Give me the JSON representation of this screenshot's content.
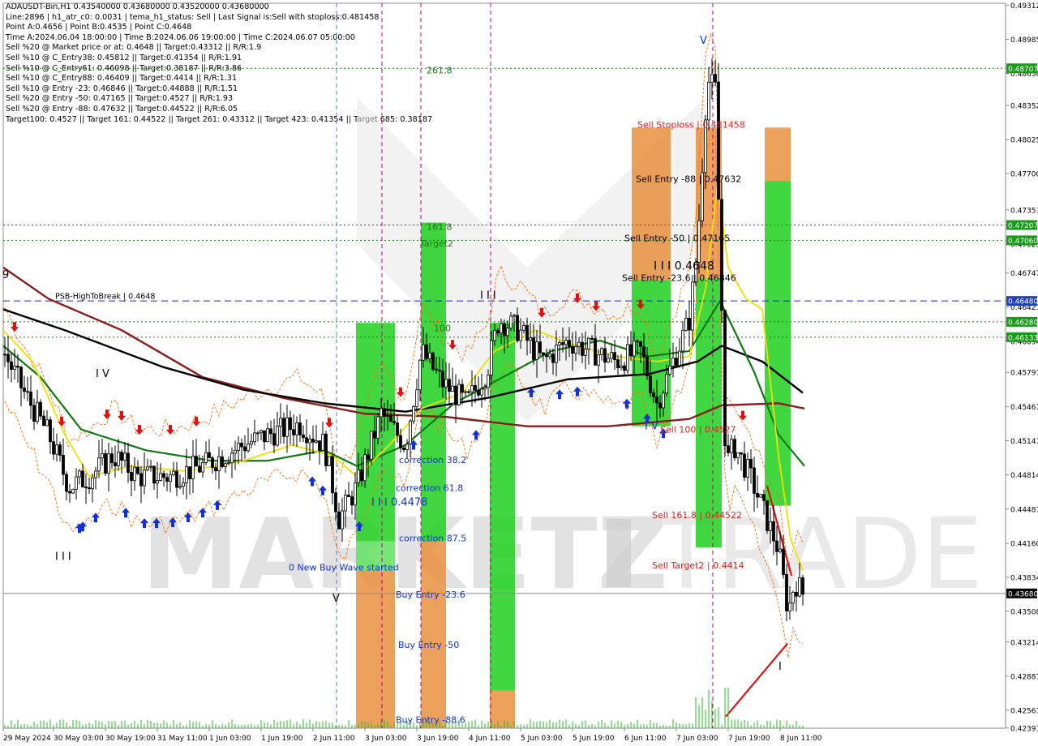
{
  "info_lines": [
    "ADAUSDT-Bin,H1  0.43540000 0.43680000 0.43520000 0.43680000",
    "Line:2896  |  h1_atr_c0: 0.0031  |  tema_h1_status: Sell  |  Last Signal is:Sell with stoploss:0.481458",
    "Point A:0.4656  |  Point B:0.4535  |  Point C:0.4648",
    "Time A:2024.06.04 18:00:00  |  Time B:2024.06.06 19:00:00  |  Time C:2024.06.07 05:00:00",
    "Sell %20 @ Market price or at: 0.4648  ||  Target:0.43312  ||  R/R:1.9",
    "Sell %10 @ C_Entry38: 0.45812  ||  Target:0.41354  ||  R/R:1.91",
    "Sell %10 @ C_Entry61: 0.46098  ||  Target:0.38187  ||  R/R:3.86",
    "Sell %10 @ C_Entry88: 0.46409  ||  Target:0.4414  ||  R/R:1.31",
    "Sell %10 @ Entry -23: 0.46846  ||  Target:0.44888  ||  R/R:1.51",
    "Sell %20 @ Entry -50: 0.47165  ||  Target:0.4527  ||  R/R:1.93",
    "Sell %20 @ Entry -88: 0.47632  ||  Target:0.44522  ||  R/R:6.05",
    "Target100: 0.4527  ||  Target 161: 0.44522  ||  Target 261: 0.43312  ||  Target 423: 0.41354  ||  Target 685: 0.38187"
  ],
  "colors": {
    "bg": "#ffffff",
    "grid": "#c8c8c8",
    "candle": "#000000",
    "ema_green": "#0f7a0f",
    "ema_black": "#000000",
    "ema_red": "#8b1c1c",
    "yellow": "#f0e000",
    "orange_band": "#ff6a00",
    "box_green": "#20d020",
    "box_orange": "#e89040",
    "magenta": "#c00080",
    "blue_dash": "#2020d0",
    "level_green": "#1a7a1a",
    "price_green_bg": "#1a9a1a",
    "buy_arrow": "#1030e0",
    "sell_arrow": "#e01010"
  },
  "chart_data": {
    "type": "candlestick",
    "symbol": "ADAUSDT-Bin,H1",
    "ylim": [
      0.4239,
      0.4933
    ],
    "y_ticks": [
      "0.49312",
      "0.48985",
      "0.48658",
      "0.48352",
      "0.48025",
      "0.47700",
      "0.47351",
      "0.47025",
      "0.46747",
      "0.46421",
      "0.46094",
      "0.45797",
      "0.45467",
      "0.45141",
      "0.44814",
      "0.44487",
      "0.44160",
      "0.43834",
      "0.43508",
      "0.43214",
      "0.42887",
      "0.42561",
      "0.42391"
    ],
    "y_tick_values": [
      0.49312,
      0.48985,
      0.48658,
      0.48352,
      0.48025,
      0.477,
      0.47351,
      0.47025,
      0.46747,
      0.46421,
      0.46094,
      0.45797,
      0.45467,
      0.45141,
      0.44814,
      0.44487,
      0.4416,
      0.43834,
      0.43508,
      0.43214,
      0.42887,
      0.42561,
      0.42391
    ],
    "x_ticks": [
      "29 May 2024",
      "30 May 03:00",
      "30 May 19:00",
      "31 May 11:00",
      "1 Jun 03:00",
      "1 Jun 19:00",
      "2 Jun 11:00",
      "3 Jun 03:00",
      "3 Jun 19:00",
      "4 Jun 11:00",
      "5 Jun 03:00",
      "5 Jun 19:00",
      "6 Jun 11:00",
      "7 Jun 03:00",
      "7 Jun 19:00",
      "8 Jun 11:00"
    ],
    "levels": [
      {
        "label": "0.48707",
        "value": 0.48707,
        "style": "green-dotted"
      },
      {
        "label": "0.47207",
        "value": 0.47207,
        "style": "green-dotted"
      },
      {
        "label": "0.47060",
        "value": 0.4706,
        "style": "green-dotted"
      },
      {
        "label": "0.46480",
        "value": 0.4648,
        "style": "blue-dashed"
      },
      {
        "label": "0.46280",
        "value": 0.4628,
        "style": "green-dotted"
      },
      {
        "label": "0.46133",
        "value": 0.46133,
        "style": "green-dotted"
      },
      {
        "label": "0.43680",
        "value": 0.4368,
        "style": "current"
      }
    ],
    "annotations": [
      {
        "text": "261.8",
        "value": 0.4866,
        "color": "#1a7a1a"
      },
      {
        "text": "161.8",
        "value": 0.4716,
        "color": "#1a7a1a"
      },
      {
        "text": "Target2",
        "value": 0.47,
        "color": "#1a7a1a"
      },
      {
        "text": "100",
        "value": 0.4619,
        "color": "#1a7a1a"
      },
      {
        "text": "PSB-HighToBreak  |  0.4648",
        "value": 0.465,
        "color": "#000000"
      },
      {
        "text": "correction 38.2",
        "value": 0.4493,
        "color": "#1030e0"
      },
      {
        "text": "correction 61.8",
        "value": 0.4466,
        "color": "#1030e0"
      },
      {
        "text": "correction 87.5",
        "value": 0.4418,
        "color": "#1030e0"
      },
      {
        "text": "I I I  0.4478",
        "value": 0.4452,
        "color": "#1030e0"
      },
      {
        "text": "0 New Buy Wave started",
        "value": 0.439,
        "color": "#1030e0"
      },
      {
        "text": "Buy Entry -23.6",
        "value": 0.4364,
        "color": "#1030e0"
      },
      {
        "text": "Buy Entry -50",
        "value": 0.4316,
        "color": "#1030e0"
      },
      {
        "text": "Buy Entry -88.6",
        "value": 0.4244,
        "color": "#1030e0"
      },
      {
        "text": "Sell Stoploss  |  0.481458",
        "value": 0.4814,
        "color": "#e02020"
      },
      {
        "text": "Sell Entry -88  |  0.47632",
        "value": 0.4762,
        "color": "#000000"
      },
      {
        "text": "Sell Entry -50  |  0.47165",
        "value": 0.4705,
        "color": "#000000"
      },
      {
        "text": "I I I  0.4648",
        "value": 0.4678,
        "color": "#000000"
      },
      {
        "text": "Sell Entry -23.6  |  0.46846",
        "value": 0.4667,
        "color": "#000000"
      },
      {
        "text": "Sell 100  |  0.4527",
        "value": 0.4522,
        "color": "#e02020"
      },
      {
        "text": "Sell 161.8  |  0.44522",
        "value": 0.444,
        "color": "#e02020"
      },
      {
        "text": "Sell Target2  |  0.4414",
        "value": 0.4392,
        "color": "#e02020"
      }
    ],
    "wave_labels": [
      "9",
      "I V",
      "I I I",
      "V",
      "I I I",
      "I V",
      "V",
      "I"
    ],
    "grid": false
  }
}
